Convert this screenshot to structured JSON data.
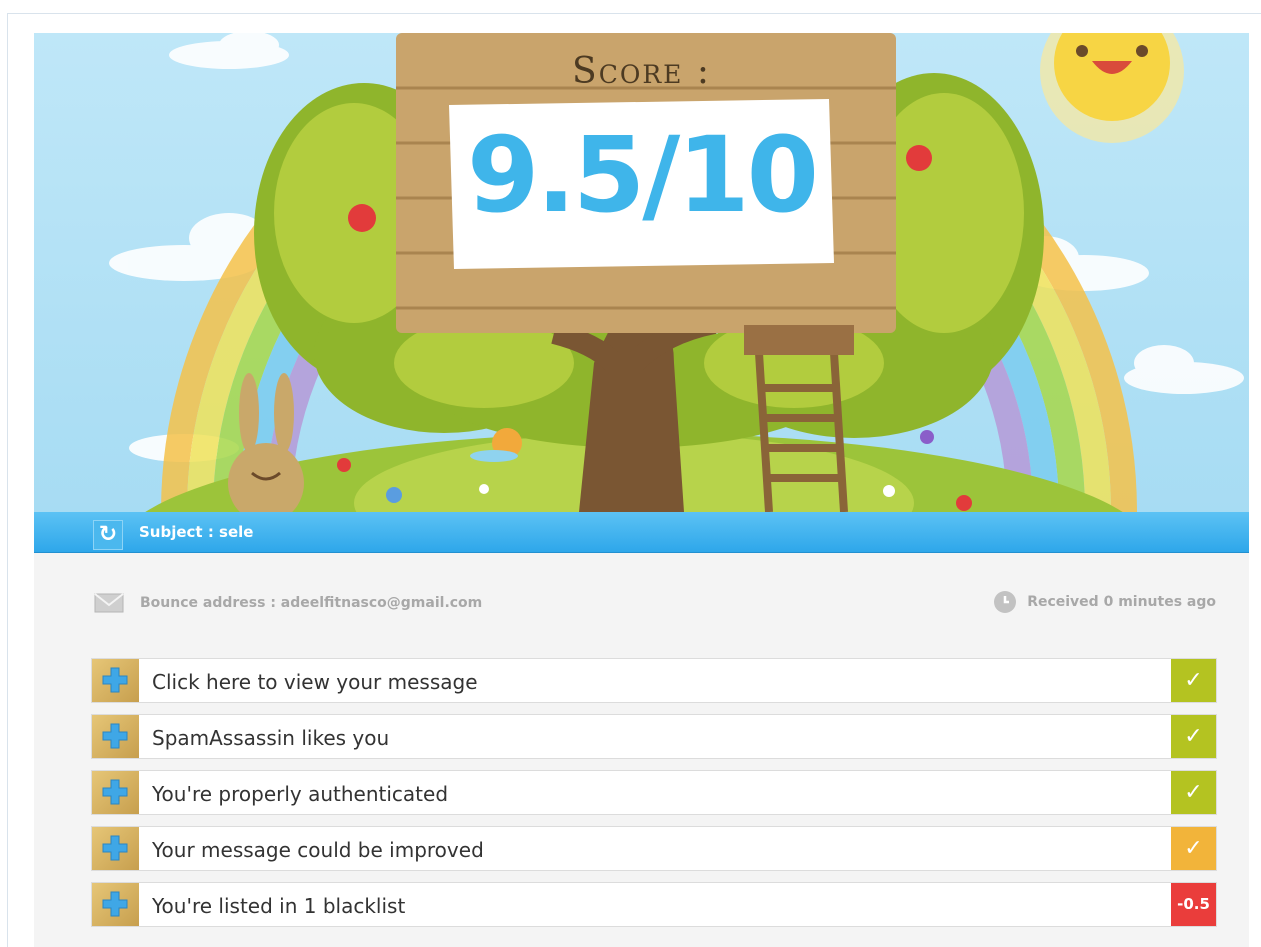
{
  "score": {
    "label": "Score :",
    "value": "9.5/10"
  },
  "subject": {
    "label": "Subject : sele"
  },
  "meta": {
    "bounce": "Bounce address : adeelfitnasco@gmail.com",
    "received": "Received 0 minutes ago"
  },
  "checks": [
    {
      "label": "Click here to view your message",
      "status": "✓",
      "level": "ok"
    },
    {
      "label": "SpamAssassin likes you",
      "status": "✓",
      "level": "ok"
    },
    {
      "label": "You're properly authenticated",
      "status": "✓",
      "level": "ok"
    },
    {
      "label": "Your message could be improved",
      "status": "✓",
      "level": "warn"
    },
    {
      "label": "You're listed in 1 blacklist",
      "status": "-0.5",
      "level": "bad"
    }
  ],
  "icons": {
    "refresh": "refresh-icon",
    "mail": "mail-icon",
    "clock": "clock-icon",
    "expand": "plus-icon"
  },
  "colors": {
    "accent_blue": "#2ea7ea",
    "score_blue": "#3fb5ea",
    "ok_green": "#b4c321",
    "warn_orange": "#f2b43a",
    "bad_red": "#ea3d3b"
  }
}
